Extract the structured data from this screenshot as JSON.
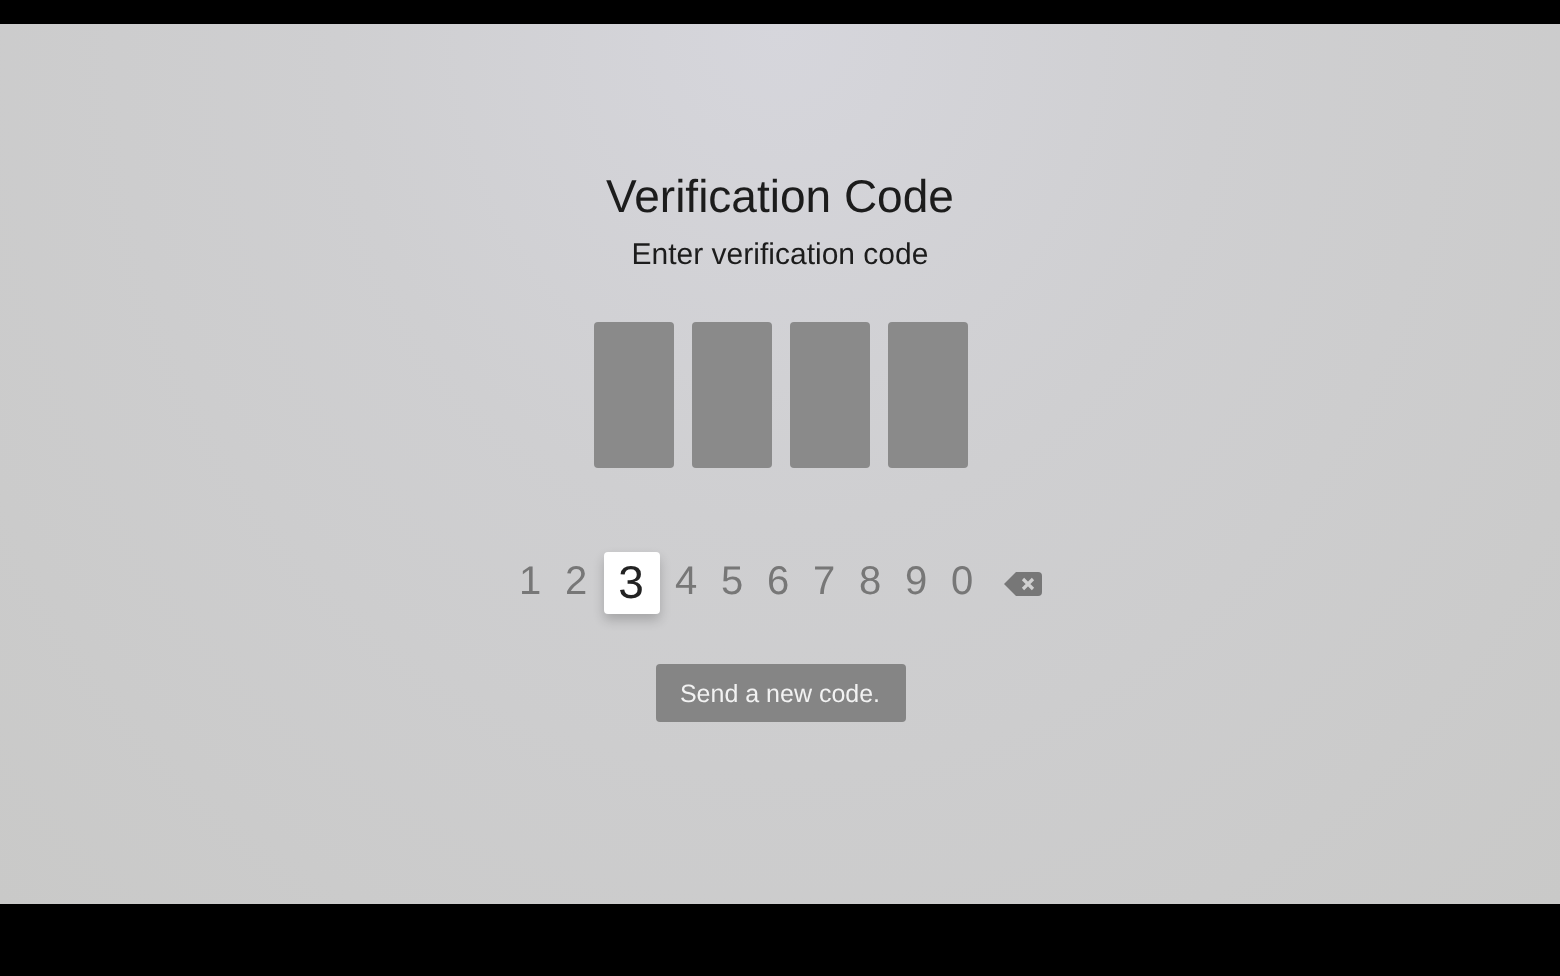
{
  "title": "Verification Code",
  "subtitle": "Enter verification code",
  "code_slots": [
    {
      "filled": false
    },
    {
      "filled": false
    },
    {
      "filled": false
    },
    {
      "filled": false
    }
  ],
  "keys": [
    {
      "kind": "digit",
      "label": "1",
      "selected": false
    },
    {
      "kind": "digit",
      "label": "2",
      "selected": false
    },
    {
      "kind": "digit",
      "label": "3",
      "selected": true
    },
    {
      "kind": "digit",
      "label": "4",
      "selected": false
    },
    {
      "kind": "digit",
      "label": "5",
      "selected": false
    },
    {
      "kind": "digit",
      "label": "6",
      "selected": false
    },
    {
      "kind": "digit",
      "label": "7",
      "selected": false
    },
    {
      "kind": "digit",
      "label": "8",
      "selected": false
    },
    {
      "kind": "digit",
      "label": "9",
      "selected": false
    },
    {
      "kind": "digit",
      "label": "0",
      "selected": false
    },
    {
      "kind": "delete",
      "selected": false
    }
  ],
  "resend_button": "Send a new code."
}
